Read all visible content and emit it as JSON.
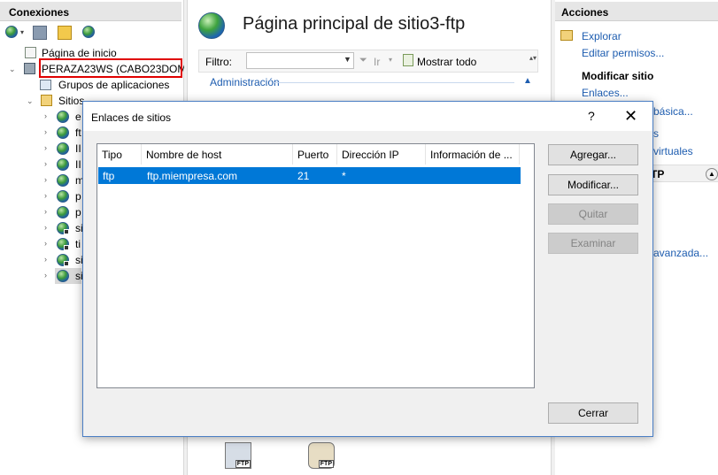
{
  "left_panel": {
    "title": "Conexiones",
    "tree": [
      {
        "label": "Página de inicio"
      },
      {
        "label": "PERAZA23WS (CABO23DOM\\"
      },
      {
        "label": "Grupos de aplicaciones"
      },
      {
        "label": "Sitios"
      },
      {
        "label": "e"
      },
      {
        "label": "ft"
      },
      {
        "label": "II"
      },
      {
        "label": "II"
      },
      {
        "label": "m"
      },
      {
        "label": "p"
      },
      {
        "label": "p"
      },
      {
        "label": "si"
      },
      {
        "label": "ti"
      },
      {
        "label": "si"
      },
      {
        "label": "si"
      }
    ]
  },
  "center": {
    "title": "Página principal de sitio3-ftp",
    "filter_label": "Filtro:",
    "filter_value": "",
    "ir_label": "Ir",
    "show_all_label": "Mostrar todo",
    "section_label": "Administración",
    "ftp_tag": "FTP"
  },
  "right_panel": {
    "title": "Acciones",
    "explore": "Explorar",
    "edit_permissions": "Editar permisos...",
    "modify_site_head": "Modificar sitio",
    "bindings": "Enlaces...",
    "basic": "básica...",
    "s_link": "s",
    "virtual": "virtuales",
    "ftp_section": "TP",
    "advanced": "avanzada..."
  },
  "dialog": {
    "title": "Enlaces de sitios",
    "help": "?",
    "close": "✕",
    "columns": [
      "Tipo",
      "Nombre de host",
      "Puerto",
      "Dirección IP",
      "Información de ..."
    ],
    "rows": [
      {
        "tipo": "ftp",
        "host": "ftp.miempresa.com",
        "puerto": "21",
        "ip": "*",
        "info": ""
      }
    ],
    "buttons": {
      "add": "Agregar...",
      "modify": "Modificar...",
      "remove": "Quitar",
      "browse": "Examinar",
      "close": "Cerrar"
    }
  }
}
